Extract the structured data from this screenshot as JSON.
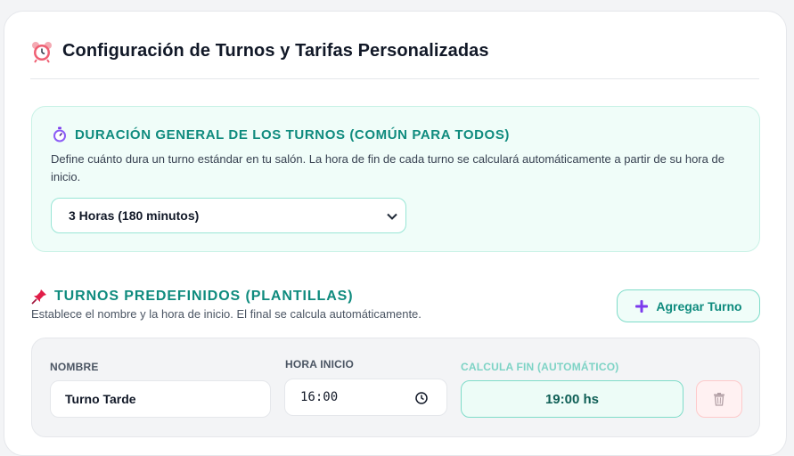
{
  "header": {
    "title": "Configuración de Turnos y Tarifas Personalizadas",
    "icon": "alarm-clock-icon"
  },
  "duration": {
    "title": "DURACIÓN GENERAL DE LOS TURNOS (COMÚN PARA TODOS)",
    "icon": "stopwatch-icon",
    "description": "Define cuánto dura un turno estándar en tu salón. La hora de fin de cada turno se calculará automáticamente a partir de su hora de inicio.",
    "selected": "3 Horas (180 minutos)"
  },
  "presets": {
    "title": "TURNOS PREDEFINIDOS (PLANTILLAS)",
    "icon": "pushpin-icon",
    "description": "Establece el nombre y la hora de inicio. El final se calcula automáticamente.",
    "add_button": "Agregar Turno",
    "labels": {
      "name": "NOMBRE",
      "start": "HORA INICIO",
      "end": "CALCULA FIN (AUTOMÁTICO)"
    },
    "rows": [
      {
        "name": "Turno Tarde",
        "start": "16:00",
        "end": "19:00 hs"
      }
    ]
  },
  "colors": {
    "accent": "#0f8b7e",
    "accent_bg": "#f0fdf9",
    "danger_bg": "#fff1f2"
  }
}
